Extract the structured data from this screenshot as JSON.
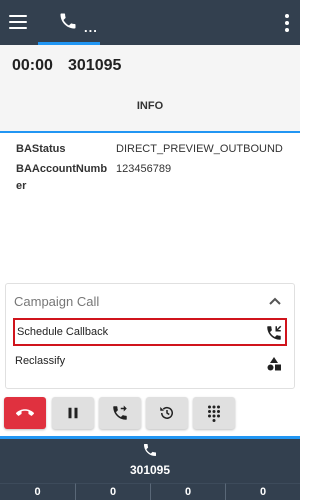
{
  "topbar": {
    "menu_icon": "hamburger-icon",
    "tab_icon": "phone-icon",
    "tab_dots": "...",
    "overflow_icon": "kebab-icon",
    "accent": "#2196f3",
    "bg": "#33404f"
  },
  "call": {
    "timer": "00:00",
    "number": "301095",
    "tab_label": "INFO"
  },
  "fields": [
    {
      "key": "BAStatus",
      "value": "DIRECT_PREVIEW_OUTBOUND"
    },
    {
      "key": "BAAccountNumber",
      "value": "123456789"
    }
  ],
  "campaign": {
    "title": "Campaign Call",
    "schedule_label": "Schedule Callback",
    "reclassify_label": "Reclassify",
    "highlight_color": "#d0141c"
  },
  "controls": [
    {
      "name": "hangup",
      "icon": "hangup-icon",
      "color": "#e0313f"
    },
    {
      "name": "hold",
      "icon": "pause-icon"
    },
    {
      "name": "transfer",
      "icon": "call-forward-icon"
    },
    {
      "name": "history",
      "icon": "history-icon"
    },
    {
      "name": "dialpad",
      "icon": "dialpad-icon"
    }
  ],
  "bottom": {
    "number": "301095",
    "counters": [
      "0",
      "0",
      "0",
      "0"
    ]
  }
}
